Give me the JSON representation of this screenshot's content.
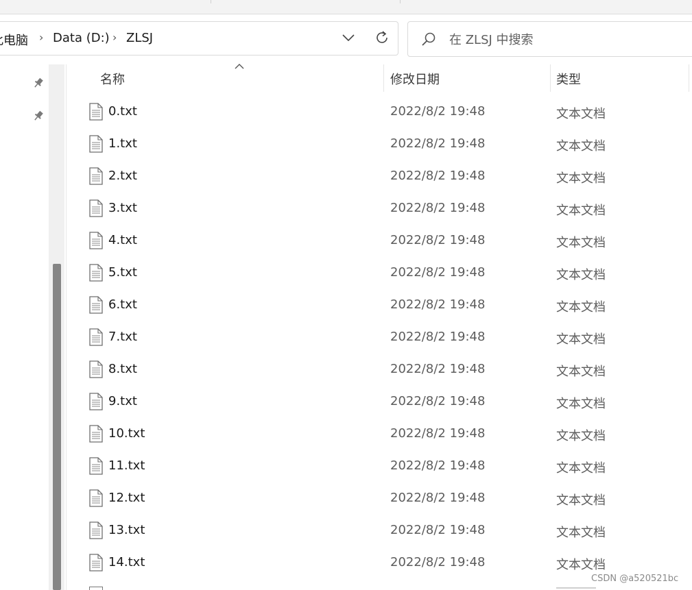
{
  "address_bar": {
    "breadcrumbs": [
      "此电脑",
      "Data (D:)",
      "ZLSJ"
    ],
    "dropdown_icon": "chevron-down-icon",
    "refresh_icon": "refresh-icon"
  },
  "search": {
    "placeholder": "在 ZLSJ 中搜索",
    "icon": "search-icon"
  },
  "columns": {
    "name": "名称",
    "modified": "修改日期",
    "type": "类型",
    "sort_indicator": "sort-ascending-icon"
  },
  "files": [
    {
      "name": "0.txt",
      "modified": "2022/8/2 19:48",
      "type": "文本文档"
    },
    {
      "name": "1.txt",
      "modified": "2022/8/2 19:48",
      "type": "文本文档"
    },
    {
      "name": "2.txt",
      "modified": "2022/8/2 19:48",
      "type": "文本文档"
    },
    {
      "name": "3.txt",
      "modified": "2022/8/2 19:48",
      "type": "文本文档"
    },
    {
      "name": "4.txt",
      "modified": "2022/8/2 19:48",
      "type": "文本文档"
    },
    {
      "name": "5.txt",
      "modified": "2022/8/2 19:48",
      "type": "文本文档"
    },
    {
      "name": "6.txt",
      "modified": "2022/8/2 19:48",
      "type": "文本文档"
    },
    {
      "name": "7.txt",
      "modified": "2022/8/2 19:48",
      "type": "文本文档"
    },
    {
      "name": "8.txt",
      "modified": "2022/8/2 19:48",
      "type": "文本文档"
    },
    {
      "name": "9.txt",
      "modified": "2022/8/2 19:48",
      "type": "文本文档"
    },
    {
      "name": "10.txt",
      "modified": "2022/8/2 19:48",
      "type": "文本文档"
    },
    {
      "name": "11.txt",
      "modified": "2022/8/2 19:48",
      "type": "文本文档"
    },
    {
      "name": "12.txt",
      "modified": "2022/8/2 19:48",
      "type": "文本文档"
    },
    {
      "name": "13.txt",
      "modified": "2022/8/2 19:48",
      "type": "文本文档"
    },
    {
      "name": "14.txt",
      "modified": "2022/8/2 19:48",
      "type": "文本文档"
    }
  ],
  "watermark": "CSDN @a520521bc",
  "colors": {
    "scroll_thumb": "#858585",
    "date_text": "#5c5c5c",
    "header_text": "#3b3b3b"
  }
}
